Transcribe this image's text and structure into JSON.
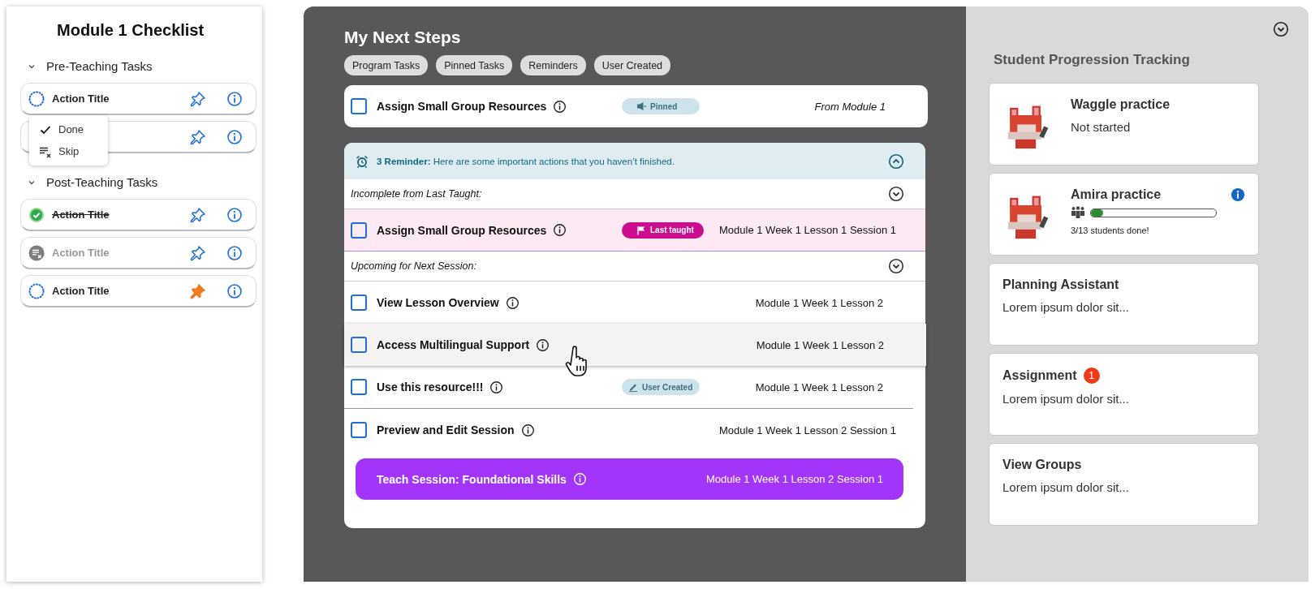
{
  "checklist": {
    "title": "Module 1 Checklist",
    "sections": [
      {
        "title": "Pre-Teaching Tasks",
        "items": [
          {
            "title": "Action Title",
            "kind": "todo",
            "pinned": false
          },
          {
            "pinned": false
          }
        ]
      },
      {
        "title": "Post-Teaching Tasks",
        "items": [
          {
            "title": "Action Title",
            "kind": "done",
            "pinned": false
          },
          {
            "title": "Action Title",
            "kind": "skipped",
            "pinned": false
          },
          {
            "title": "Action Title",
            "kind": "todo",
            "pinned": true
          }
        ]
      }
    ],
    "status_menu": [
      {
        "kind": "done",
        "label": "Done"
      },
      {
        "kind": "skip",
        "label": "Skip"
      }
    ]
  },
  "next_steps": {
    "title": "My Next Steps",
    "filters": [
      "Program Tasks",
      "Pinned Tasks",
      "Reminders",
      "User Created"
    ],
    "pinned_task": {
      "title": "Assign Small Group Resources",
      "checked": false,
      "badge": {
        "kind": "pinned",
        "label": "Pinned"
      },
      "source": "From Module 1"
    },
    "reminder": {
      "text": "**3 Reminder:** Here are some important actions that you haven’t finished.",
      "groups": [
        {
          "title": "Incomplete from Last Taught:",
          "tasks": [
            {
              "kind": "task",
              "title": "Assign Small Group Resources",
              "checked": false,
              "last_taught": true,
              "badge": {
                "kind": "last-taught",
                "label": "Last taught"
              },
              "location": "Module 1 Week 1 Lesson 1 Session 1"
            }
          ]
        },
        {
          "title": "Upcoming for Next Session:",
          "tasks": [
            {
              "kind": "task",
              "title": "View Lesson Overview",
              "checked": false,
              "location": "Module 1 Week 1 Lesson 2"
            },
            {
              "kind": "task",
              "title": "Access Multilingual Support",
              "checked": false,
              "hovered": true,
              "location": "Module 1 Week 1 Lesson 2"
            },
            {
              "kind": "task",
              "title": "Use this resource!!!",
              "checked": false,
              "badge": {
                "kind": "user-created",
                "label": "User Created"
              },
              "location": "Module 1 Week 1 Lesson 2",
              "separator_below": true
            },
            {
              "kind": "task",
              "title": "Preview and Edit Session",
              "checked": false,
              "location": "Module 1 Week 1 Lesson 2 Session 1"
            },
            {
              "kind": "teach",
              "title": "Teach Session: Foundational Skills",
              "location": "Module 1 Week 1 Lesson 2 Session 1"
            }
          ]
        }
      ]
    }
  },
  "progression": {
    "title": "Student Progression Tracking",
    "cards": [
      {
        "kind": "practice",
        "title": "Waggle practice",
        "subtitle": "Not started"
      },
      {
        "kind": "progress",
        "title": "Amira practice",
        "info": true,
        "level": 0.1,
        "caption": "3/13 students done!"
      },
      {
        "kind": "text",
        "title": "Planning Assistant",
        "body": "Lorem ipsum dolor sit..."
      },
      {
        "kind": "text",
        "title": "Assignment",
        "badge": "1",
        "body": "Lorem ipsum dolor sit..."
      },
      {
        "kind": "text",
        "title": "View Groups",
        "body": "Lorem ipsum dolor sit..."
      }
    ]
  }
}
